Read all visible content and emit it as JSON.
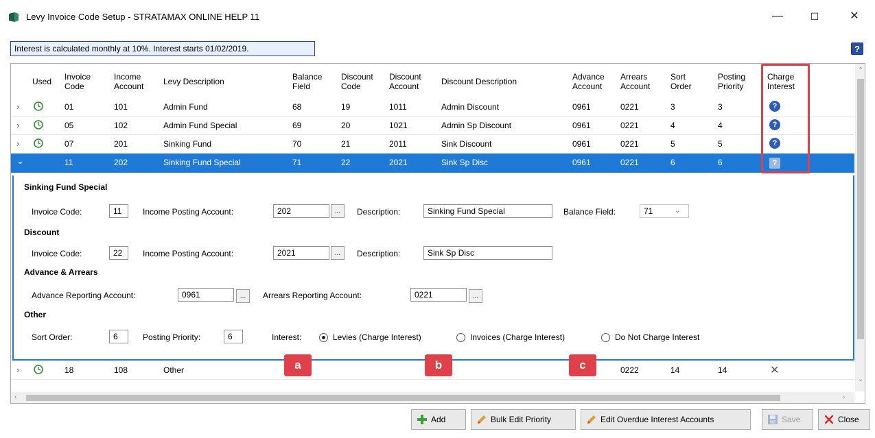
{
  "window": {
    "title": "Levy Invoice Code Setup - STRATAMAX ONLINE HELP 11",
    "minimize": "—",
    "maximize": "☐",
    "close": "✕"
  },
  "info_banner": "Interest is calculated monthly at 10%. Interest starts 01/02/2019.",
  "help_button": "?",
  "grid": {
    "headers": {
      "used": "Used",
      "invoice_code": [
        "Invoice",
        "Code"
      ],
      "income_account": [
        "Income",
        "Account"
      ],
      "levy_description": "Levy Description",
      "balance_field": [
        "Balance",
        "Field"
      ],
      "discount_code": [
        "Discount",
        "Code"
      ],
      "discount_account": [
        "Discount",
        "Account"
      ],
      "discount_description": "Discount Description",
      "advance_account": [
        "Advance",
        "Account"
      ],
      "arrears_account": [
        "Arrears",
        "Account"
      ],
      "sort_order": [
        "Sort",
        "Order"
      ],
      "posting_priority": [
        "Posting",
        "Priority"
      ],
      "charge_interest": [
        "Charge",
        "Interest"
      ]
    },
    "rows": [
      {
        "code": "01",
        "income": "101",
        "desc": "Admin Fund",
        "balance": "68",
        "disc_code": "19",
        "disc_acct": "1011",
        "disc_desc": "Admin Discount",
        "advance": "0961",
        "arrears": "0221",
        "sort": "3",
        "priority": "3",
        "interest": "?"
      },
      {
        "code": "05",
        "income": "102",
        "desc": "Admin Fund Special",
        "balance": "69",
        "disc_code": "20",
        "disc_acct": "1021",
        "disc_desc": "Admin Sp Discount",
        "advance": "0961",
        "arrears": "0221",
        "sort": "4",
        "priority": "4",
        "interest": "?"
      },
      {
        "code": "07",
        "income": "201",
        "desc": "Sinking Fund",
        "balance": "70",
        "disc_code": "21",
        "disc_acct": "2011",
        "disc_desc": "Sink Discount",
        "advance": "0961",
        "arrears": "0221",
        "sort": "5",
        "priority": "5",
        "interest": "?"
      },
      {
        "code": "11",
        "income": "202",
        "desc": "Sinking Fund Special",
        "balance": "71",
        "disc_code": "22",
        "disc_acct": "2021",
        "disc_desc": "Sink Sp Disc",
        "advance": "0961",
        "arrears": "0221",
        "sort": "6",
        "priority": "6",
        "interest": "?"
      },
      {
        "code": "18",
        "income": "108",
        "desc": "Other",
        "arrears": "0222",
        "sort": "14",
        "priority": "14",
        "interest": "✕"
      }
    ]
  },
  "detail": {
    "title": "Sinking Fund Special",
    "invoice_code_label": "Invoice Code:",
    "invoice_code": "11",
    "income_posting_label": "Income Posting Account:",
    "income_posting": "202",
    "description_label": "Description:",
    "description": "Sinking Fund Special",
    "balance_field_label": "Balance Field:",
    "balance_field": "71",
    "discount_title": "Discount",
    "discount_invoice_code": "22",
    "discount_income_posting": "2021",
    "discount_description": "Sink Sp Disc",
    "adv_title": "Advance & Arrears",
    "advance_label": "Advance Reporting Account:",
    "advance_value": "0961",
    "arrears_label": "Arrears Reporting Account:",
    "arrears_value": "0221",
    "other_title": "Other",
    "sort_order_label": "Sort Order:",
    "sort_order": "6",
    "posting_priority_label": "Posting Priority:",
    "posting_priority": "6",
    "interest_label": "Interest:",
    "interest_options": [
      "Levies (Charge Interest)",
      "Invoices (Charge Interest)",
      "Do Not Charge Interest"
    ],
    "interest_selected_index": 0,
    "ellipsis": "..."
  },
  "callouts": [
    "a",
    "b",
    "c"
  ],
  "buttons": {
    "add": "Add",
    "bulk_edit": "Bulk Edit Priority",
    "edit_overdue": "Edit Overdue Interest Accounts",
    "save": "Save",
    "close": "Close"
  },
  "colors": {
    "selection": "#1e7ad6",
    "highlight": "#e0404a",
    "accent_icon": "#2d5cb8"
  }
}
